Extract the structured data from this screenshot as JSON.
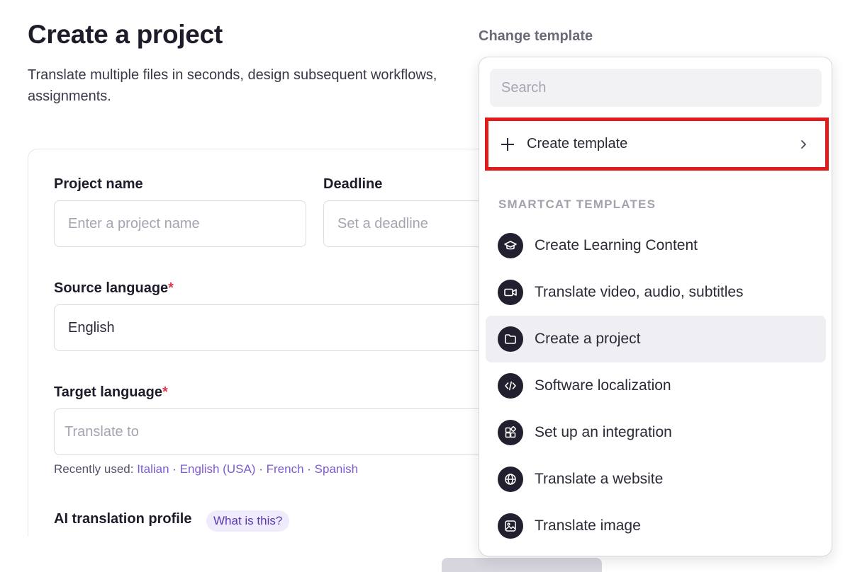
{
  "page": {
    "title": "Create a project",
    "subtitle": "Translate multiple files in seconds, design subsequent workflows, assignments."
  },
  "form": {
    "project_name": {
      "label": "Project name",
      "placeholder": "Enter a project name"
    },
    "deadline": {
      "label": "Deadline",
      "placeholder": "Set a deadline"
    },
    "source_language": {
      "label": "Source language",
      "required_mark": "*",
      "value": "English"
    },
    "target_language": {
      "label": "Target language",
      "required_mark": "*",
      "placeholder": "Translate to"
    },
    "recently_used": {
      "label": "Recently used:",
      "separator": "·",
      "languages": [
        "Italian",
        "English (USA)",
        "French",
        "Spanish"
      ]
    },
    "ai_profile": {
      "label": "AI translation profile",
      "help_badge": "What is this?"
    }
  },
  "template_picker": {
    "heading": "Change template",
    "search_placeholder": "Search",
    "create_template_label": "Create template",
    "section_title": "SMARTCAT TEMPLATES",
    "items": [
      {
        "label": "Create Learning Content",
        "icon": "graduation-cap-icon"
      },
      {
        "label": "Translate video, audio, subtitles",
        "icon": "video-camera-icon"
      },
      {
        "label": "Create a project",
        "icon": "folder-icon",
        "selected": true
      },
      {
        "label": "Software localization",
        "icon": "code-icon"
      },
      {
        "label": "Set up an integration",
        "icon": "integration-blocks-icon"
      },
      {
        "label": "Translate a website",
        "icon": "globe-icon"
      },
      {
        "label": "Translate image",
        "icon": "image-icon"
      }
    ]
  },
  "colors": {
    "accent": "#7d5bd1",
    "highlight_border": "#e01b1b",
    "required": "#e0364a",
    "icon_bg": "#22202f"
  }
}
